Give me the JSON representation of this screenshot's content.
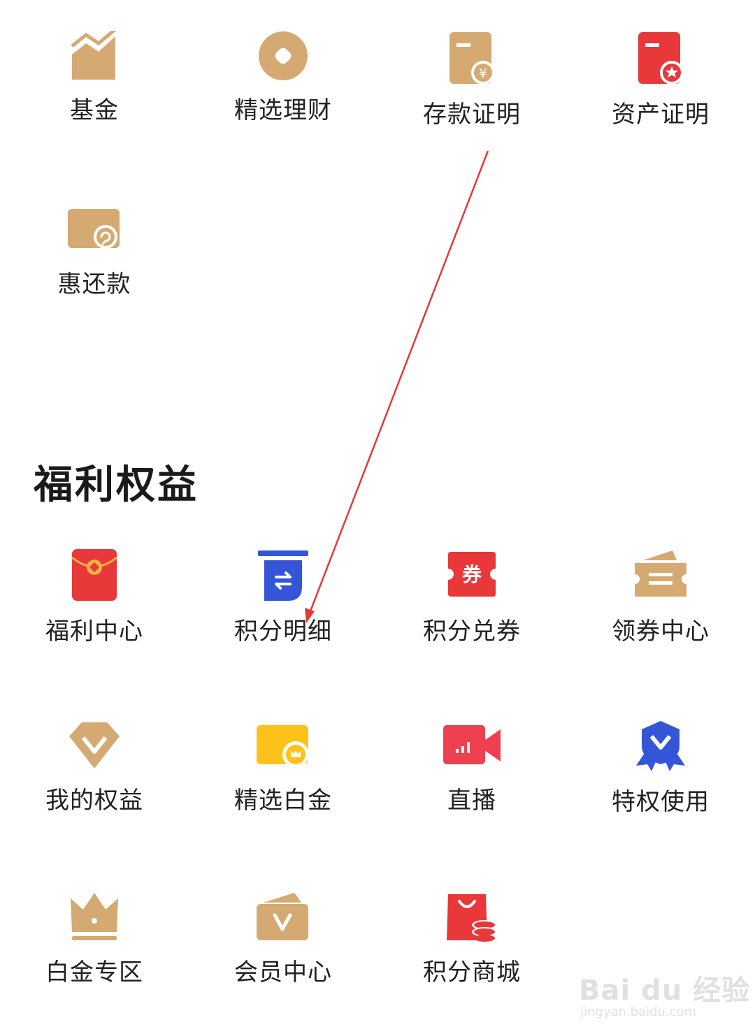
{
  "top_grid": {
    "items": [
      {
        "label": "基金",
        "icon": "fund-chart-icon"
      },
      {
        "label": "精选理财",
        "icon": "wealth-coin-icon"
      },
      {
        "label": "存款证明",
        "icon": "deposit-certificate-icon"
      },
      {
        "label": "资产证明",
        "icon": "asset-certificate-icon"
      },
      {
        "label": "惠还款",
        "icon": "repayment-card-icon"
      }
    ]
  },
  "benefits": {
    "title": "福利权益",
    "items": [
      {
        "label": "福利中心",
        "icon": "red-envelope-icon"
      },
      {
        "label": "积分明细",
        "icon": "points-detail-icon"
      },
      {
        "label": "积分兑券",
        "icon": "coupon-exchange-icon"
      },
      {
        "label": "领券中心",
        "icon": "coupon-wallet-icon"
      },
      {
        "label": "我的权益",
        "icon": "diamond-v-icon"
      },
      {
        "label": "精选白金",
        "icon": "platinum-card-icon"
      },
      {
        "label": "直播",
        "icon": "live-video-icon"
      },
      {
        "label": "特权使用",
        "icon": "privilege-badge-icon"
      },
      {
        "label": "白金专区",
        "icon": "crown-icon"
      },
      {
        "label": "会员中心",
        "icon": "member-wallet-icon"
      },
      {
        "label": "积分商城",
        "icon": "points-mall-bag-icon"
      }
    ]
  },
  "colors": {
    "gold": "#D4AA72",
    "red": "#E8383A",
    "blue": "#3555D8",
    "yellow": "#FFC21A"
  },
  "watermark": {
    "brand": "Bai du 经验",
    "url": "jingyan.baidu.com"
  }
}
